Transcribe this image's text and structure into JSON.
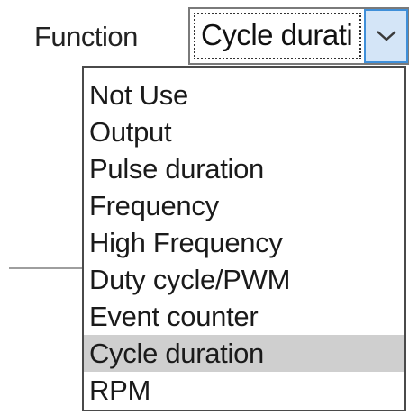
{
  "field": {
    "label": "Function"
  },
  "combo": {
    "value": "Cycle durati",
    "button_icon": "chevron-down-icon"
  },
  "dropdown": {
    "items": [
      {
        "label": "Not Use",
        "selected": false
      },
      {
        "label": "Output",
        "selected": false
      },
      {
        "label": "Pulse duration",
        "selected": false
      },
      {
        "label": "Frequency",
        "selected": false
      },
      {
        "label": "High Frequency",
        "selected": false
      },
      {
        "label": "Duty cycle/PWM",
        "selected": false
      },
      {
        "label": "Event counter",
        "selected": false
      },
      {
        "label": "Cycle duration",
        "selected": true
      },
      {
        "label": "RPM",
        "selected": false
      }
    ],
    "selected_highlight_color": "#cfcfcf"
  },
  "colors": {
    "button_fill": "#d4e5f7",
    "button_border": "#3f8fd9"
  }
}
